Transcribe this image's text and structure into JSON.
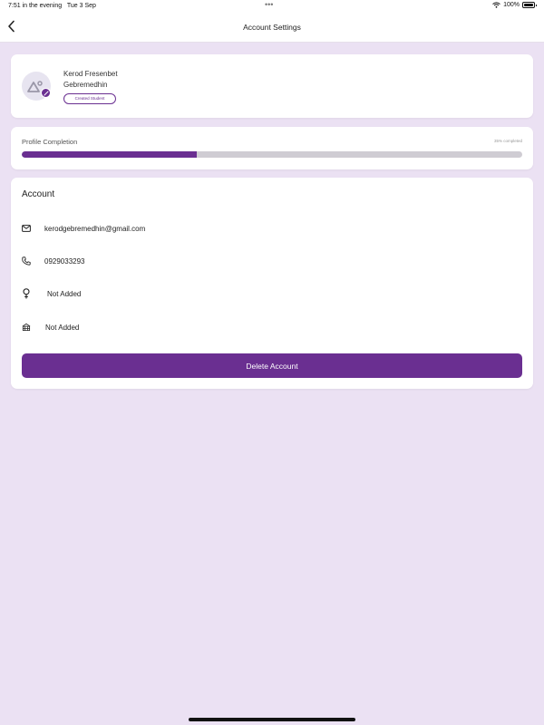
{
  "status_bar": {
    "time": "7:51 in the evening",
    "date": "Tue 3 Sep",
    "dots": "•••",
    "battery": "100%",
    "wifi_icon": "wifi-icon",
    "battery_icon": "battery-icon"
  },
  "nav": {
    "title": "Account Settings",
    "back_icon": "chevron-left-icon"
  },
  "profile": {
    "first_name": "Kerod Fresenbet",
    "last_name": "Gebremedhin",
    "role": "Created Student",
    "avatar_icon": "image-placeholder-icon",
    "edit_icon": "pencil-icon"
  },
  "completion": {
    "label": "Profile Completion",
    "percent_text": "35% completed",
    "value": 0.35
  },
  "account": {
    "title": "Account",
    "items": [
      {
        "icon": "mail-icon",
        "text": "kerodgebremedhin@gmail.com"
      },
      {
        "icon": "phone-icon",
        "text": "0929033293"
      },
      {
        "icon": "gender-female-icon",
        "text": "Not Added"
      },
      {
        "icon": "school-icon",
        "text": "Not Added"
      }
    ],
    "delete_label": "Delete Account"
  },
  "colors": {
    "accent": "#6a2f91",
    "background": "#ebe1f3",
    "track": "#cfccd3"
  }
}
